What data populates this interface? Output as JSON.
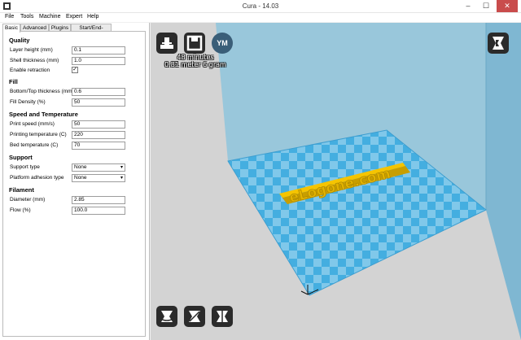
{
  "window": {
    "title": "Cura - 14.03",
    "min_glyph": "–",
    "max_glyph": "☐",
    "close_glyph": "✕"
  },
  "menu": [
    "File",
    "Tools",
    "Machine",
    "Expert",
    "Help"
  ],
  "tabs": [
    "Basic",
    "Advanced",
    "Plugins",
    "Start/End-GCode"
  ],
  "quality": {
    "header": "Quality",
    "layer_height_label": "Layer height (mm)",
    "layer_height_value": "0.1",
    "shell_thickness_label": "Shell thickness (mm)",
    "shell_thickness_value": "1.0",
    "retraction_label": "Enable retraction",
    "retraction_checked": true
  },
  "fill": {
    "header": "Fill",
    "bottom_top_label": "Bottom/Top thickness (mm)",
    "bottom_top_value": "0.6",
    "density_label": "Fill Density (%)",
    "density_value": "50"
  },
  "speed": {
    "header": "Speed and Temperature",
    "print_speed_label": "Print speed (mm/s)",
    "print_speed_value": "50",
    "print_temp_label": "Printing temperature (C)",
    "print_temp_value": "220",
    "bed_temp_label": "Bed temperature (C)",
    "bed_temp_value": "70"
  },
  "support": {
    "header": "Support",
    "support_type_label": "Support type",
    "support_type_value": "None",
    "adhesion_label": "Platform adhesion type",
    "adhesion_value": "None"
  },
  "filament": {
    "header": "Filament",
    "diameter_label": "Diameter (mm)",
    "diameter_value": "2.85",
    "flow_label": "Flow (%)",
    "flow_value": "100.0"
  },
  "viewport": {
    "ym_label": "YM",
    "time": "48 minutes",
    "material": "0.81 meter 6 gram",
    "model_text": "eLogone.com",
    "colors": {
      "build_volume": "#8ec4dc",
      "platform_a": "#44aee0",
      "platform_b": "#80c8ea",
      "model": "#f5c400"
    }
  }
}
